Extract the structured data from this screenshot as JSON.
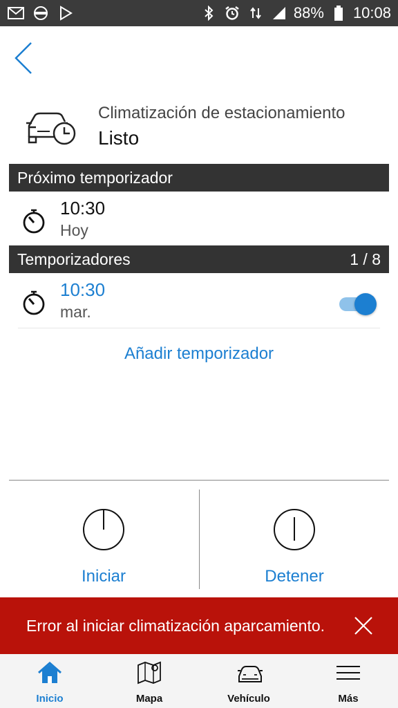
{
  "status_bar": {
    "battery": "88%",
    "time": "10:08",
    "left_icons": [
      "gmail-icon",
      "volvo-icon",
      "play-store-icon"
    ],
    "right_icons": [
      "bluetooth-icon",
      "alarm-icon",
      "data-arrows-icon",
      "signal-icon",
      "battery-icon"
    ]
  },
  "header": {
    "title": "Climatización de estacionamiento",
    "status": "Listo",
    "icon": "car-timer-icon"
  },
  "next_timer": {
    "section_label": "Próximo temporizador",
    "time": "10:30",
    "day": "Hoy"
  },
  "timers": {
    "section_label": "Temporizadores",
    "count": "1 / 8",
    "items": [
      {
        "time": "10:30",
        "day": "mar.",
        "enabled": true
      }
    ],
    "add_label": "Añadir temporizador"
  },
  "actions": {
    "start_label": "Iniciar",
    "stop_label": "Detener"
  },
  "error": {
    "message": "Error al iniciar climatización aparcamiento."
  },
  "nav": {
    "items": [
      {
        "label": "Inicio",
        "icon": "home-icon",
        "active": true
      },
      {
        "label": "Mapa",
        "icon": "map-icon",
        "active": false
      },
      {
        "label": "Vehículo",
        "icon": "car-icon",
        "active": false
      },
      {
        "label": "Más",
        "icon": "menu-icon",
        "active": false
      }
    ]
  },
  "colors": {
    "accent": "#1c7fd1",
    "error": "#b9120a",
    "section_bar": "#333333",
    "status_bar": "#3b3b3b"
  }
}
